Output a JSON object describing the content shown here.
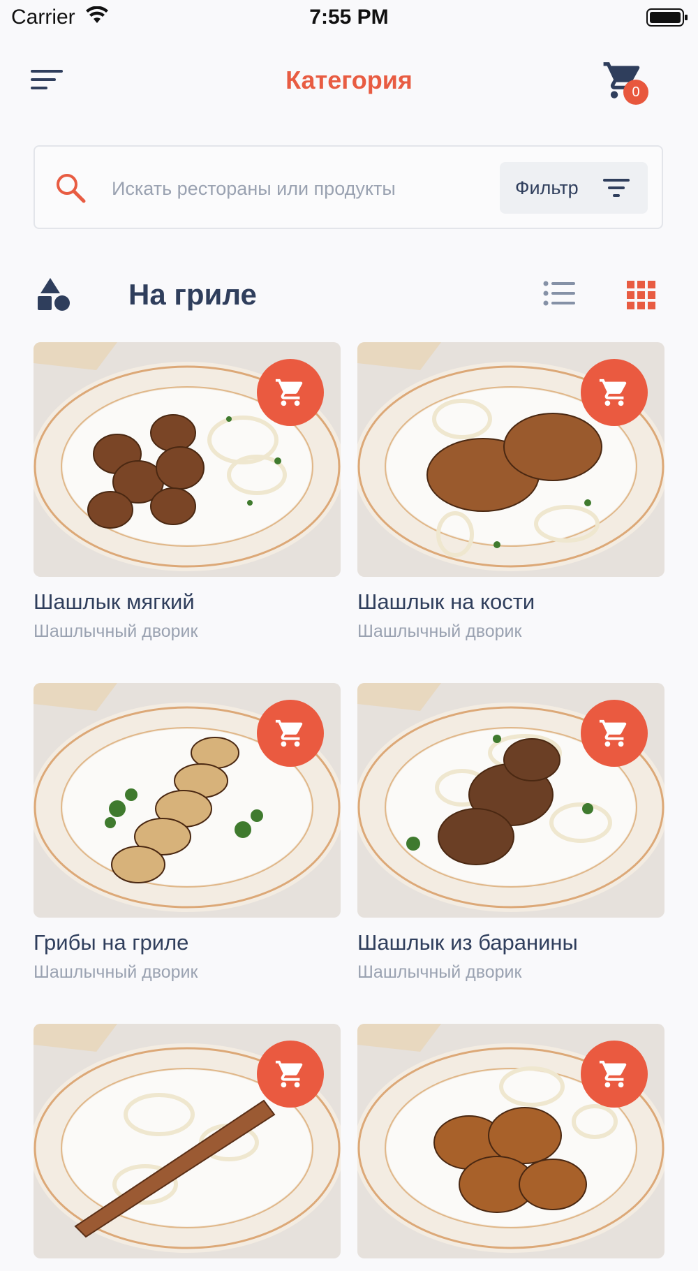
{
  "status_bar": {
    "carrier": "Carrier",
    "time": "7:55 PM"
  },
  "header": {
    "title": "Категория",
    "cart_count": "0"
  },
  "search": {
    "placeholder": "Искать рестораны или продукты",
    "filter_label": "Фильтр"
  },
  "section": {
    "title": "На гриле"
  },
  "colors": {
    "accent": "#e85c42",
    "text": "#2f3e5c",
    "muted": "#9aa2b1",
    "background": "#f9f9fb"
  },
  "products": [
    {
      "name": "Шашлык мягкий",
      "vendor": "Шашлычный дворик",
      "icon": "add-to-cart-icon"
    },
    {
      "name": "Шашлык на кости",
      "vendor": "Шашлычный дворик",
      "icon": "add-to-cart-icon"
    },
    {
      "name": "Грибы на гриле",
      "vendor": "Шашлычный дворик",
      "icon": "add-to-cart-icon"
    },
    {
      "name": "Шашлык из баранины",
      "vendor": "Шашлычный дворик",
      "icon": "add-to-cart-icon"
    },
    {
      "name": "",
      "vendor": "",
      "icon": "add-to-cart-icon"
    },
    {
      "name": "",
      "vendor": "",
      "icon": "add-to-cart-icon"
    }
  ]
}
